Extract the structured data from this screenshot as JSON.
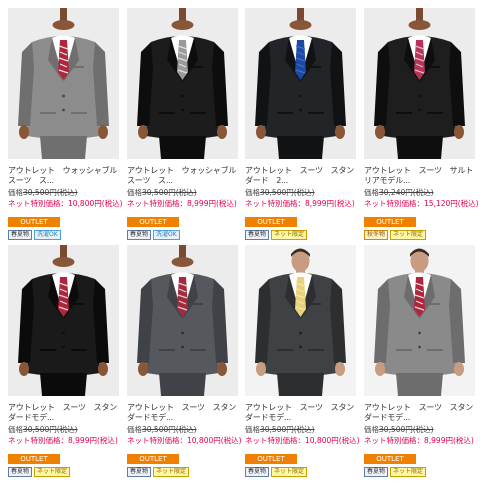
{
  "colors": {
    "outlet_badge": "#f08000",
    "net_price_text": "#e5004f",
    "image_bg": "#ececec"
  },
  "products": [
    {
      "name": "アウトレット　ウォッシャブルスーツ　ス...",
      "reg_label": "価格",
      "reg_price": "30,500円(税込)",
      "net_label": "ネット特別価格",
      "net_price": "10,800円(税込)",
      "outlet": "OUTLET",
      "badges": [
        {
          "text": "春夏物",
          "kind": "season"
        },
        {
          "text": "洗濯OK",
          "kind": "wash"
        }
      ],
      "suit": {
        "body": "#8c8c8c",
        "shade": "#6f6f6f",
        "tie": "#b0243c",
        "tie2": "#e6e6e6",
        "shirt": "#ffffff",
        "bg": "#ececec"
      }
    },
    {
      "name": "アウトレット　ウォッシャブルスーツ　ス...",
      "reg_label": "価格",
      "reg_price": "30,500円(税込)",
      "net_label": "ネット特別価格",
      "net_price": "8,999円(税込)",
      "outlet": "OUTLET",
      "badges": [
        {
          "text": "春夏物",
          "kind": "season"
        },
        {
          "text": "洗濯OK",
          "kind": "wash"
        }
      ],
      "suit": {
        "body": "#1c1c1c",
        "shade": "#0d0d0d",
        "tie": "#9a9a9a",
        "tie2": "#e0e0e0",
        "shirt": "#ffffff",
        "bg": "#ececec"
      }
    },
    {
      "name": "アウトレット　スーツ　スタンダード　2...",
      "reg_label": "価格",
      "reg_price": "30,500円(税込)",
      "net_label": "ネット特別価格",
      "net_price": "8,999円(税込)",
      "outlet": "OUTLET",
      "badges": [
        {
          "text": "春夏物",
          "kind": "season"
        },
        {
          "text": "ネット限定",
          "kind": "limited"
        }
      ],
      "suit": {
        "body": "#222427",
        "shade": "#111214",
        "tie": "#1b4aa3",
        "tie2": "#3a6cc9",
        "shirt": "#ffffff",
        "bg": "#ececec"
      }
    },
    {
      "name": "アウトレット　スーツ　サルトリアモデル...",
      "reg_label": "価格",
      "reg_price": "30,240円(税込)",
      "net_label": "ネット特別価格",
      "net_price": "15,120円(税込)",
      "outlet": "OUTLET",
      "badges": [
        {
          "text": "秋冬物",
          "kind": "fall"
        },
        {
          "text": "ネット限定",
          "kind": "limited"
        }
      ],
      "suit": {
        "body": "#1e1e1e",
        "shade": "#0e0e0e",
        "tie": "#b6345a",
        "tie2": "#e8b6c6",
        "shirt": "#ffffff",
        "bg": "#ececec"
      }
    },
    {
      "name": "アウトレット　スーツ　スタンダードモデ...",
      "reg_label": "価格",
      "reg_price": "30,500円(税込)",
      "net_label": "ネット特別価格",
      "net_price": "8,999円(税込)",
      "outlet": "OUTLET",
      "badges": [
        {
          "text": "春夏物",
          "kind": "season"
        },
        {
          "text": "ネット限定",
          "kind": "limited"
        }
      ],
      "suit": {
        "body": "#1a1a1a",
        "shade": "#0b0b0b",
        "tie": "#b0243c",
        "tie2": "#dddddd",
        "shirt": "#ffffff",
        "bg": "#ececec"
      }
    },
    {
      "name": "アウトレット　スーツ　スタンダードモデ...",
      "reg_label": "価格",
      "reg_price": "30,500円(税込)",
      "net_label": "ネット特別価格",
      "net_price": "10,800円(税込)",
      "outlet": "OUTLET",
      "badges": [
        {
          "text": "春夏物",
          "kind": "season"
        },
        {
          "text": "ネット限定",
          "kind": "limited"
        }
      ],
      "suit": {
        "body": "#55595e",
        "shade": "#3f4246",
        "tie": "#a52a3d",
        "tie2": "#d4d4d4",
        "shirt": "#ffffff",
        "bg": "#ececec"
      }
    },
    {
      "name": "アウトレット　スーツ　スタンダードモデ...",
      "reg_label": "価格",
      "reg_price": "30,500円(税込)",
      "net_label": "ネット特別価格",
      "net_price": "10,800円(税込)",
      "outlet": "OUTLET",
      "badges": [
        {
          "text": "春夏物",
          "kind": "season"
        },
        {
          "text": "ネット限定",
          "kind": "limited"
        }
      ],
      "suit": {
        "body": "#3f4245",
        "shade": "#2c2e30",
        "tie": "#e8d37a",
        "tie2": "#f3e6a8",
        "shirt": "#ffffff",
        "bg": "#f3f3f3",
        "model": true
      }
    },
    {
      "name": "アウトレット　スーツ　スタンダードモデ...",
      "reg_label": "価格",
      "reg_price": "30,500円(税込)",
      "net_label": "ネット特別価格",
      "net_price": "8,999円(税込)",
      "outlet": "OUTLET",
      "badges": [
        {
          "text": "春夏物",
          "kind": "season"
        },
        {
          "text": "ネット限定",
          "kind": "limited"
        }
      ],
      "suit": {
        "body": "#8a8a8a",
        "shade": "#6d6d6d",
        "tie": "#b0243c",
        "tie2": "#e2e2e2",
        "shirt": "#ffffff",
        "bg": "#f3f3f3",
        "model": true
      }
    }
  ]
}
